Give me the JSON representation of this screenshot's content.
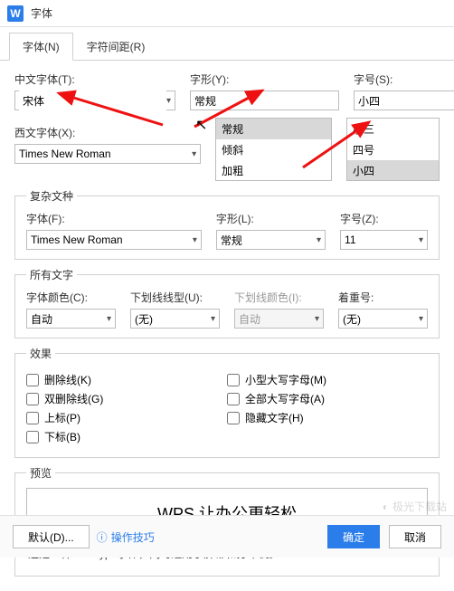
{
  "window": {
    "title": "字体"
  },
  "tabs": {
    "font": "字体(N)",
    "spacing": "字符间距(R)"
  },
  "cn": {
    "label": "中文字体(T):",
    "value": "宋体"
  },
  "style": {
    "label": "字形(Y):",
    "value": "常规",
    "opt1": "常规",
    "opt2": "倾斜",
    "opt3": "加粗"
  },
  "size": {
    "label": "字号(S):",
    "value": "小四",
    "opt1": "小三",
    "opt2": "四号",
    "opt3": "小四"
  },
  "west": {
    "label": "西文字体(X):",
    "value": "Times New Roman"
  },
  "complex": {
    "legend": "复杂文种",
    "font_label": "字体(F):",
    "font_value": "Times New Roman",
    "style_label": "字形(L):",
    "style_value": "常规",
    "size_label": "字号(Z):",
    "size_value": "11"
  },
  "allText": {
    "legend": "所有文字",
    "color_label": "字体颜色(C):",
    "color_value": "自动",
    "underline_label": "下划线线型(U):",
    "underline_value": "(无)",
    "ulcolor_label": "下划线颜色(I):",
    "ulcolor_value": "自动",
    "emphasis_label": "着重号:",
    "emphasis_value": "(无)"
  },
  "effects": {
    "legend": "效果",
    "strike": "删除线(K)",
    "dstrike": "双删除线(G)",
    "sup": "上标(P)",
    "sub": "下标(B)",
    "smallcaps": "小型大写字母(M)",
    "allcaps": "全部大写字母(A)",
    "hidden": "隐藏文字(H)"
  },
  "preview": {
    "legend": "预览",
    "text": "WPS 让办公更轻松"
  },
  "hint": "这是一种TrueType字体，同时适用于屏幕和打印机。",
  "footer": {
    "default": "默认(D)...",
    "tips": "操作技巧",
    "ok": "确定",
    "cancel": "取消"
  },
  "watermark": "极光下载站"
}
